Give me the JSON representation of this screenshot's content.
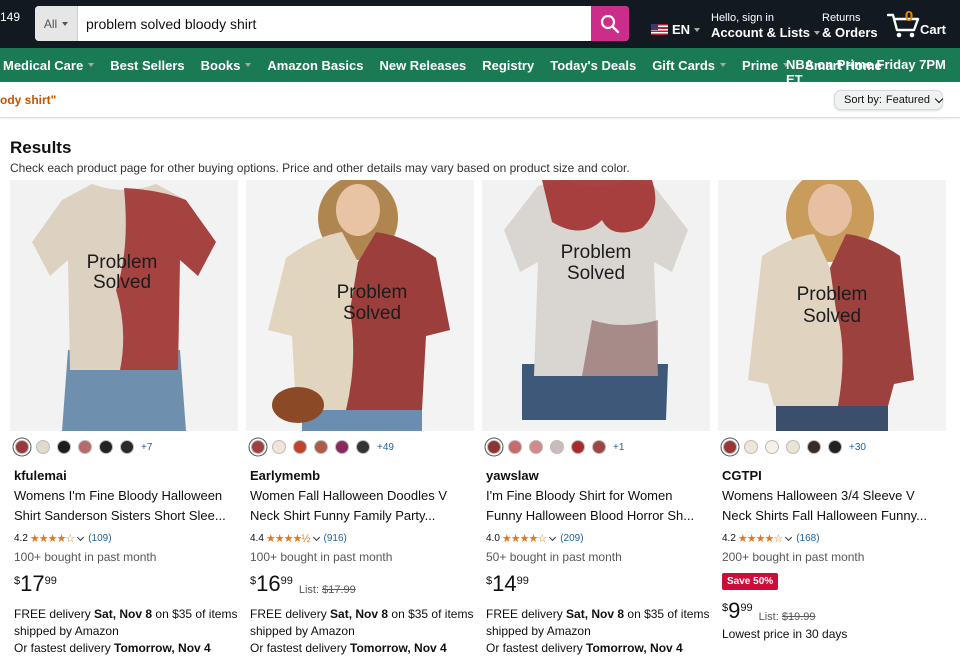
{
  "header": {
    "left_fragment": "149",
    "search_dept": "All",
    "search_query": "problem solved bloody shirt",
    "lang": "EN",
    "account_line1": "Hello, sign in",
    "account_line2": "Account & Lists",
    "orders_line1": "Returns",
    "orders_line2": "& Orders",
    "cart_count": "0",
    "cart_label": "Cart"
  },
  "nav": {
    "items": [
      "Medical Care",
      "Best Sellers",
      "Books",
      "Amazon Basics",
      "New Releases",
      "Registry",
      "Today's Deals",
      "Gift Cards",
      "Prime",
      "Smart Home"
    ],
    "promo": "NBA on Prime Friday 7PM ET"
  },
  "subbar": {
    "query_echo": "ody shirt\"",
    "sort_label": "Sort by:",
    "sort_value": "Featured"
  },
  "results": {
    "title": "Results",
    "note": "Check each product page for other buying options. Price and other details may vary based on product size and color."
  },
  "colors": {
    "header_bg": "#131921",
    "nav_bg": "#1a7a53",
    "search_button": "#cd2d8a",
    "star": "#de7921",
    "link": "#2162a1",
    "deal_red": "#cc0c39"
  },
  "products": [
    {
      "brand": "kfulemai",
      "title_line1": "Womens I'm Fine Bloody Halloween",
      "title_line2": "Shirt Sanderson Sisters Short Slee...",
      "shirt_text": "Problem Solved",
      "rating": "4.2",
      "stars": "★★★★☆",
      "reviews": "(109)",
      "bought": "100+ bought in past month",
      "price_symbol": "$",
      "price_whole": "17",
      "price_fraction": "99",
      "list_price": "",
      "delivery_prefix": "FREE delivery ",
      "delivery_date": "Sat, Nov 8",
      "delivery_suffix": " on $35 of items",
      "shipped": "shipped by Amazon",
      "fastest_prefix": "Or fastest delivery ",
      "fastest_date": "Tomorrow, Nov 4",
      "swatch_more": "+7",
      "swatches": [
        "#9b3a3a",
        "#e3d9c8",
        "#1d1d1d",
        "#b76a6a",
        "#222222",
        "#2a2a2a"
      ]
    },
    {
      "brand": "Earlymemb",
      "title_line1": "Women Fall Halloween Doodles V",
      "title_line2": "Neck Shirt Funny Family Party...",
      "shirt_text": "Problem Solved",
      "rating": "4.4",
      "stars": "★★★★½",
      "reviews": "(916)",
      "bought": "100+ bought in past month",
      "price_symbol": "$",
      "price_whole": "16",
      "price_fraction": "99",
      "list_price": "$17.99",
      "list_label": "List: ",
      "delivery_prefix": "FREE delivery ",
      "delivery_date": "Sat, Nov 8",
      "delivery_suffix": " on $35 of items",
      "shipped": "shipped by Amazon",
      "fastest_prefix": "Or fastest delivery ",
      "fastest_date": "Tomorrow, Nov 4",
      "swatch_more": "+49",
      "swatches": [
        "#a04040",
        "#f1e6d6",
        "#c0442a",
        "#b05a4a",
        "#8a2a5a",
        "#333333"
      ]
    },
    {
      "brand": "yawslaw",
      "title_line1": "I'm Fine Bloody Shirt for Women",
      "title_line2": "Funny Halloween Blood Horror Sh...",
      "shirt_text": "Problem Solved",
      "rating": "4.0",
      "stars": "★★★★☆",
      "reviews": "(209)",
      "bought": "50+ bought in past month",
      "price_symbol": "$",
      "price_whole": "14",
      "price_fraction": "99",
      "list_price": "",
      "delivery_prefix": "FREE delivery ",
      "delivery_date": "Sat, Nov 8",
      "delivery_suffix": " on $35 of items",
      "shipped": "shipped by Amazon",
      "fastest_prefix": "Or fastest delivery ",
      "fastest_date": "Tomorrow, Nov 4",
      "swatch_more": "+1",
      "swatches": [
        "#8f3434",
        "#c86b6b",
        "#d28a8a",
        "#cbb",
        "#a82a2a",
        "#9e4545"
      ]
    },
    {
      "brand": "CGTPI",
      "title_line1": "Womens Halloween 3/4 Sleeve V",
      "title_line2": "Neck Shirts Fall Halloween Funny...",
      "shirt_text": "Problem Solved",
      "rating": "4.2",
      "stars": "★★★★☆",
      "reviews": "(168)",
      "bought": "200+ bought in past month",
      "deal_badge": "Save 50%",
      "price_symbol": "$",
      "price_whole": "9",
      "price_fraction": "99",
      "list_price": "$19.99",
      "list_label": "List: ",
      "lowest": "Lowest price in 30 days",
      "swatch_more": "+30",
      "swatches": [
        "#9a3636",
        "#efe6d8",
        "#f6f1e8",
        "#ece4d2",
        "#3a2a24",
        "#222222"
      ]
    }
  ]
}
